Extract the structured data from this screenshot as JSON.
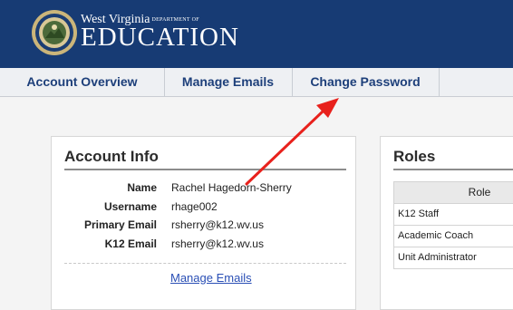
{
  "header": {
    "brand_top": "West Virginia",
    "brand_dept": "DEPARTMENT OF",
    "brand_main": "EDUCATION",
    "logo_icon": "state-seal-icon",
    "bg_color": "#173b74"
  },
  "nav": {
    "tabs": [
      {
        "label": "Account Overview"
      },
      {
        "label": "Manage Emails"
      },
      {
        "label": "Change Password"
      }
    ]
  },
  "account_info": {
    "title": "Account Info",
    "fields": [
      {
        "label": "Name",
        "value": "Rachel Hagedorn-Sherry"
      },
      {
        "label": "Username",
        "value": "rhage002"
      },
      {
        "label": "Primary Email",
        "value": "rsherry@k12.wv.us"
      },
      {
        "label": "K12 Email",
        "value": "rsherry@k12.wv.us"
      }
    ],
    "link": "Manage Emails"
  },
  "roles": {
    "title": "Roles",
    "column": "Role",
    "rows": [
      "K12 Staff",
      "Academic Coach",
      "Unit Administrator"
    ]
  },
  "annotation": {
    "arrow_icon": "red-arrow-icon",
    "color": "#e8211c"
  }
}
